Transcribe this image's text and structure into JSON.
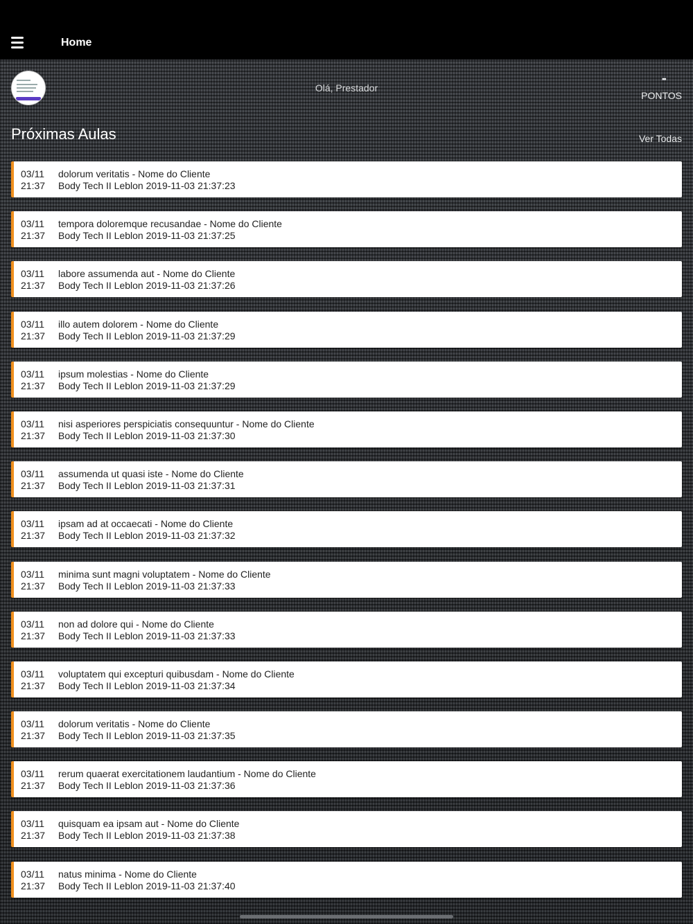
{
  "header": {
    "title": "Home",
    "menu_icon": "hamburger-menu-icon"
  },
  "profile": {
    "greeting": "Olá, Prestador",
    "points_value": "-",
    "points_label": "PONTOS"
  },
  "section": {
    "title": "Próximas Aulas",
    "see_all": "Ver Todas"
  },
  "colors": {
    "accent": "#f0901e",
    "topbar": "#000000",
    "card": "#ffffff"
  },
  "classes": [
    {
      "date": "03/11",
      "time": "21:37",
      "title": "dolorum veritatis - Nome do Cliente",
      "location": "Body Tech II Leblon 2019-11-03 21:37:23"
    },
    {
      "date": "03/11",
      "time": "21:37",
      "title": "tempora doloremque recusandae - Nome do Cliente",
      "location": "Body Tech II Leblon 2019-11-03 21:37:25"
    },
    {
      "date": "03/11",
      "time": "21:37",
      "title": "labore assumenda aut - Nome do Cliente",
      "location": "Body Tech II Leblon 2019-11-03 21:37:26"
    },
    {
      "date": "03/11",
      "time": "21:37",
      "title": "illo autem dolorem - Nome do Cliente",
      "location": "Body Tech II Leblon 2019-11-03 21:37:29"
    },
    {
      "date": "03/11",
      "time": "21:37",
      "title": "ipsum molestias - Nome do Cliente",
      "location": "Body Tech II Leblon 2019-11-03 21:37:29"
    },
    {
      "date": "03/11",
      "time": "21:37",
      "title": "nisi asperiores perspiciatis consequuntur - Nome do Cliente",
      "location": "Body Tech II Leblon 2019-11-03 21:37:30"
    },
    {
      "date": "03/11",
      "time": "21:37",
      "title": "assumenda ut quasi iste - Nome do Cliente",
      "location": "Body Tech II Leblon 2019-11-03 21:37:31"
    },
    {
      "date": "03/11",
      "time": "21:37",
      "title": "ipsam ad at occaecati - Nome do Cliente",
      "location": "Body Tech II Leblon 2019-11-03 21:37:32"
    },
    {
      "date": "03/11",
      "time": "21:37",
      "title": "minima sunt magni voluptatem - Nome do Cliente",
      "location": "Body Tech II Leblon 2019-11-03 21:37:33"
    },
    {
      "date": "03/11",
      "time": "21:37",
      "title": "non ad dolore qui - Nome do Cliente",
      "location": "Body Tech II Leblon 2019-11-03 21:37:33"
    },
    {
      "date": "03/11",
      "time": "21:37",
      "title": "voluptatem qui excepturi quibusdam - Nome do Cliente",
      "location": "Body Tech II Leblon 2019-11-03 21:37:34"
    },
    {
      "date": "03/11",
      "time": "21:37",
      "title": "dolorum veritatis - Nome do Cliente",
      "location": "Body Tech II Leblon 2019-11-03 21:37:35"
    },
    {
      "date": "03/11",
      "time": "21:37",
      "title": "rerum quaerat exercitationem laudantium - Nome do Cliente",
      "location": "Body Tech II Leblon 2019-11-03 21:37:36"
    },
    {
      "date": "03/11",
      "time": "21:37",
      "title": "quisquam ea ipsam aut - Nome do Cliente",
      "location": "Body Tech II Leblon 2019-11-03 21:37:38"
    },
    {
      "date": "03/11",
      "time": "21:37",
      "title": "natus minima - Nome do Cliente",
      "location": "Body Tech II Leblon 2019-11-03 21:37:40"
    }
  ]
}
